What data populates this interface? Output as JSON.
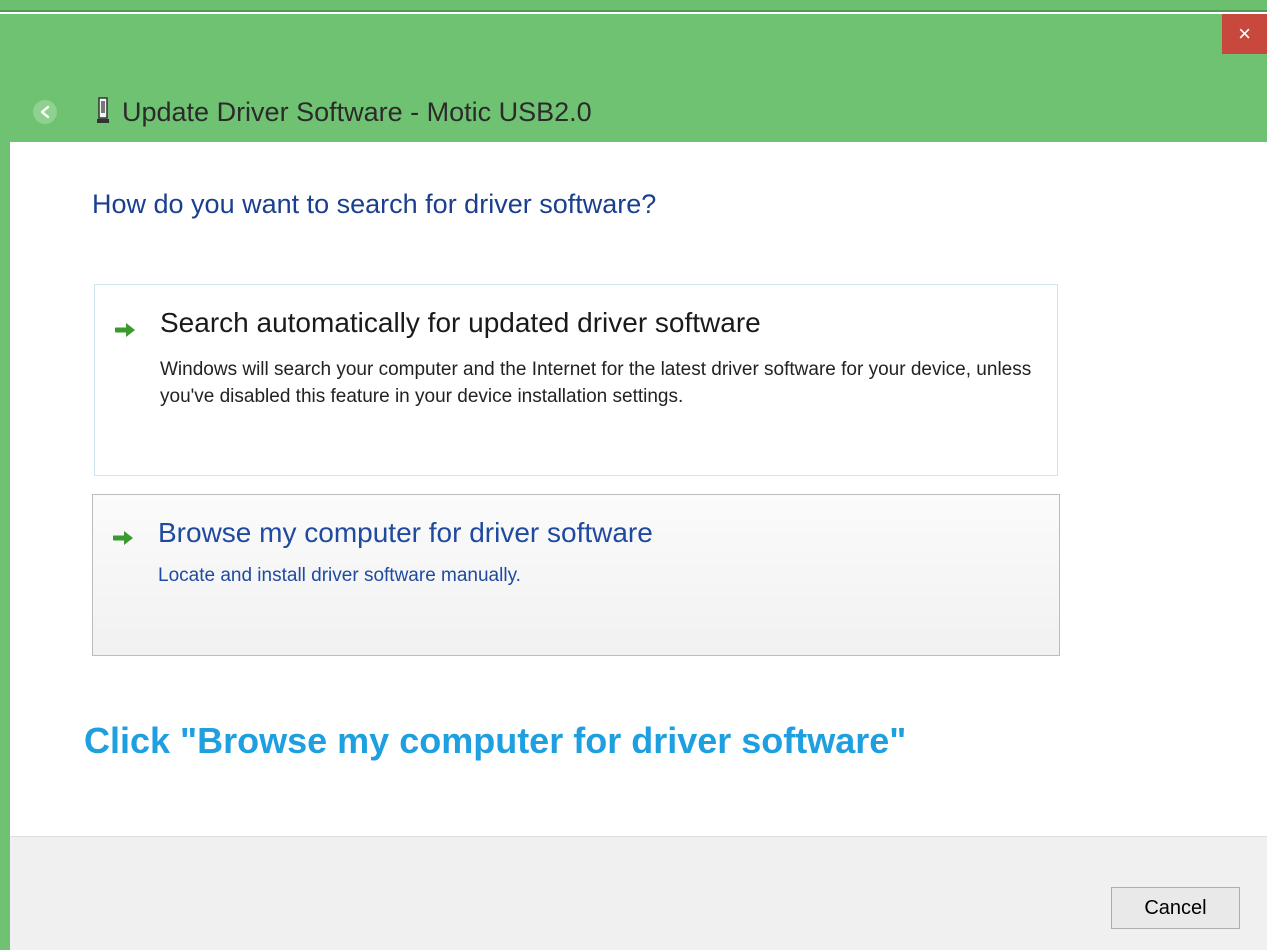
{
  "window": {
    "title": "Update Driver Software - Motic USB2.0",
    "close_label": "×",
    "accent_color": "#70c273"
  },
  "icons": {
    "back": "back-arrow-icon",
    "device": "usb-device-icon",
    "option_arrow": "green-arrow-icon",
    "close": "close-icon"
  },
  "main": {
    "heading": "How do you want to search for driver software?",
    "options": [
      {
        "title": "Search automatically for updated driver software",
        "description": "Windows will search your computer and the Internet for the latest driver software for your device, unless you've disabled this feature in your device installation settings."
      },
      {
        "title": "Browse my computer for driver software",
        "description": "Locate and install driver software manually."
      }
    ],
    "annotation": "Click \"Browse my computer for driver software\""
  },
  "footer": {
    "cancel_label": "Cancel"
  }
}
